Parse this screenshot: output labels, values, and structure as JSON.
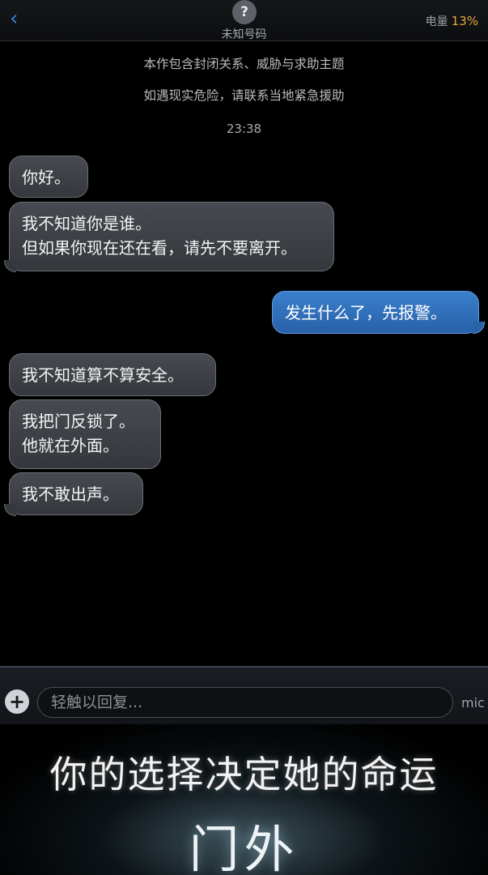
{
  "header": {
    "back_icon": "‹",
    "avatar_glyph": "?",
    "contact_name": "未知号码",
    "battery_label": "电量",
    "battery_percent": "13%"
  },
  "notices": [
    "本作包含封闭关系、威胁与求助主题",
    "如遇现实危险，请联系当地紧急援助"
  ],
  "timestamp": "23:38",
  "messages": [
    {
      "side": "in",
      "text": "你好。"
    },
    {
      "side": "in",
      "text": "我不知道你是谁。\n但如果你现在还在看，请先不要离开。"
    },
    {
      "side": "out",
      "text": "发生什么了，先报警。"
    },
    {
      "side": "in",
      "text": "我不知道算不算安全。"
    },
    {
      "side": "in",
      "text": "我把门反锁了。\n他就在外面。"
    },
    {
      "side": "in",
      "text": "我不敢出声。"
    }
  ],
  "input": {
    "plus_glyph": "+",
    "placeholder": "轻触以回复...",
    "mic_label": "mic"
  },
  "banner": {
    "slogan": "你的选择决定她的命运",
    "title": "门外"
  },
  "colors": {
    "accent": "#2f86d6",
    "battery_warning": "#e4a93a",
    "outgoing_bubble": "#3b7fcc",
    "incoming_bubble": "#474a50"
  }
}
